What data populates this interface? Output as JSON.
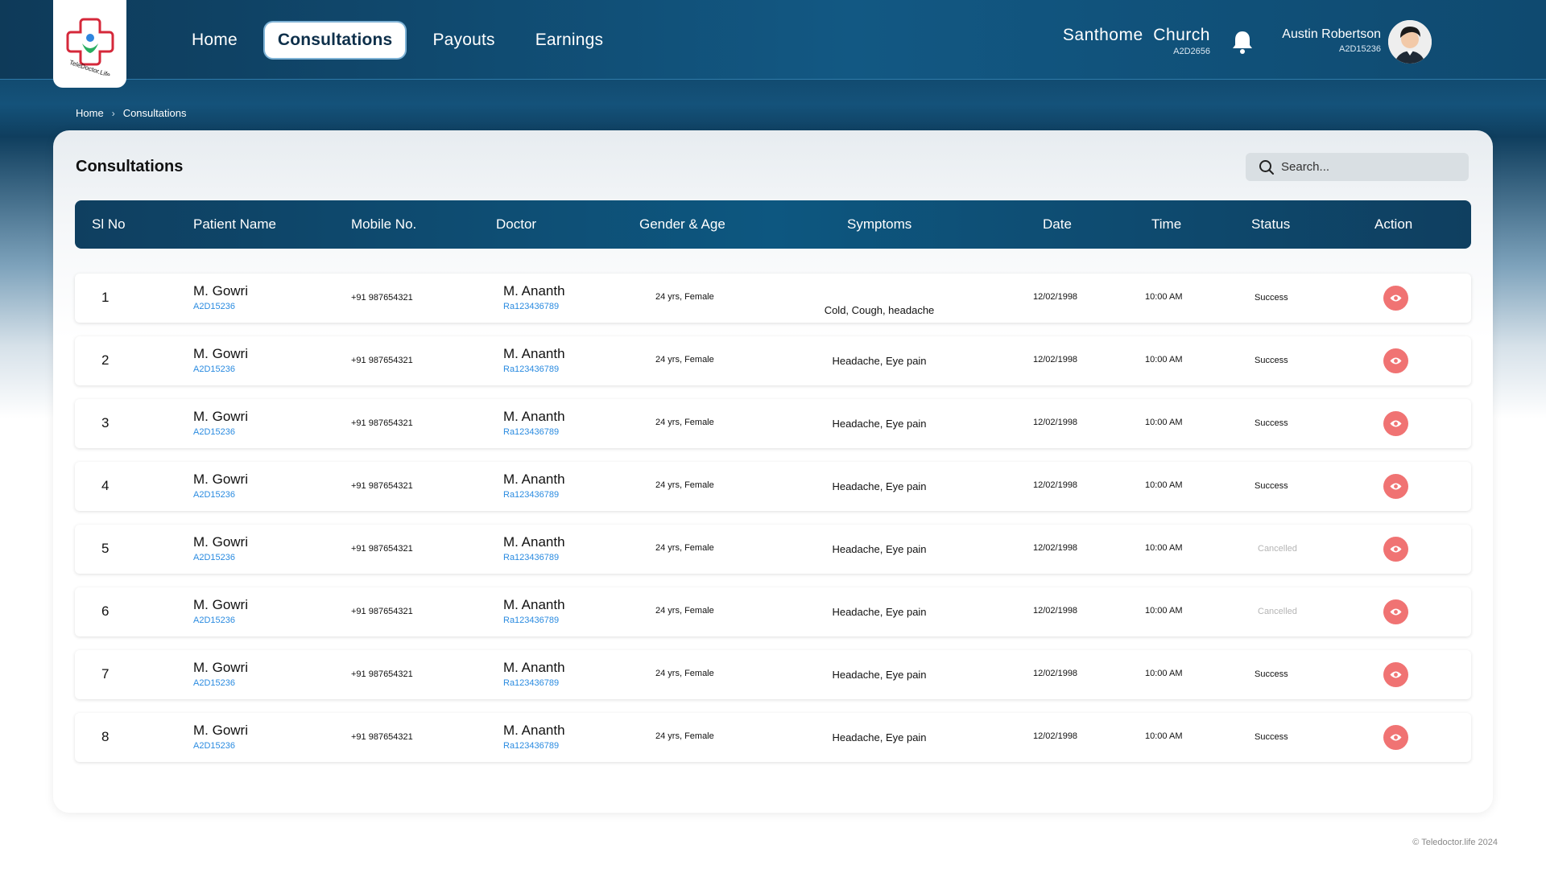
{
  "nav": {
    "logo_text": "TeleDoctor.Life",
    "items": [
      {
        "label": "Home",
        "active": false
      },
      {
        "label": "Consultations",
        "active": true
      },
      {
        "label": "Payouts",
        "active": false
      },
      {
        "label": "Earnings",
        "active": false
      }
    ]
  },
  "org": {
    "name": "Santhome  Church",
    "code": "A2D2656"
  },
  "user": {
    "name": "Austin Robertson",
    "code": "A2D15236"
  },
  "breadcrumb": {
    "home": "Home",
    "current": "Consultations"
  },
  "page": {
    "title": "Consultations",
    "search_placeholder": "Search..."
  },
  "table": {
    "headers": {
      "sl": "Sl No",
      "patient": "Patient Name",
      "mobile": "Mobile No.",
      "doctor": "Doctor",
      "gender": "Gender & Age",
      "symptoms": "Symptoms",
      "date": "Date",
      "time": "Time",
      "status": "Status",
      "action": "Action"
    },
    "rows": [
      {
        "sl": "1",
        "patient": "M. Gowri",
        "patient_id": "A2D15236",
        "mobile": "+91 987654321",
        "doctor": "M. Ananth",
        "doctor_id": "Ra123436789",
        "gender": "24 yrs, Female",
        "symptoms": "Cold, Cough, headache",
        "date": "12/02/1998",
        "time": "10:00 AM",
        "status": "Success"
      },
      {
        "sl": "2",
        "patient": "M. Gowri",
        "patient_id": "A2D15236",
        "mobile": "+91 987654321",
        "doctor": "M. Ananth",
        "doctor_id": "Ra123436789",
        "gender": "24 yrs, Female",
        "symptoms": "Headache, Eye pain",
        "date": "12/02/1998",
        "time": "10:00 AM",
        "status": "Success"
      },
      {
        "sl": "3",
        "patient": "M. Gowri",
        "patient_id": "A2D15236",
        "mobile": "+91 987654321",
        "doctor": "M. Ananth",
        "doctor_id": "Ra123436789",
        "gender": "24 yrs, Female",
        "symptoms": "Headache, Eye pain",
        "date": "12/02/1998",
        "time": "10:00 AM",
        "status": "Success"
      },
      {
        "sl": "4",
        "patient": "M. Gowri",
        "patient_id": "A2D15236",
        "mobile": "+91 987654321",
        "doctor": "M. Ananth",
        "doctor_id": "Ra123436789",
        "gender": "24 yrs, Female",
        "symptoms": "Headache, Eye pain",
        "date": "12/02/1998",
        "time": "10:00 AM",
        "status": "Success"
      },
      {
        "sl": "5",
        "patient": "M. Gowri",
        "patient_id": "A2D15236",
        "mobile": "+91 987654321",
        "doctor": "M. Ananth",
        "doctor_id": "Ra123436789",
        "gender": "24 yrs, Female",
        "symptoms": "Headache, Eye pain",
        "date": "12/02/1998",
        "time": "10:00 AM",
        "status": "Cancelled"
      },
      {
        "sl": "6",
        "patient": "M. Gowri",
        "patient_id": "A2D15236",
        "mobile": "+91 987654321",
        "doctor": "M. Ananth",
        "doctor_id": "Ra123436789",
        "gender": "24 yrs, Female",
        "symptoms": "Headache, Eye pain",
        "date": "12/02/1998",
        "time": "10:00 AM",
        "status": "Cancelled"
      },
      {
        "sl": "7",
        "patient": "M. Gowri",
        "patient_id": "A2D15236",
        "mobile": "+91 987654321",
        "doctor": "M. Ananth",
        "doctor_id": "Ra123436789",
        "gender": "24 yrs, Female",
        "symptoms": "Headache, Eye pain",
        "date": "12/02/1998",
        "time": "10:00 AM",
        "status": "Success"
      },
      {
        "sl": "8",
        "patient": "M. Gowri",
        "patient_id": "A2D15236",
        "mobile": "+91 987654321",
        "doctor": "M. Ananth",
        "doctor_id": "Ra123436789",
        "gender": "24 yrs, Female",
        "symptoms": "Headache, Eye pain",
        "date": "12/02/1998",
        "time": "10:00 AM",
        "status": "Success"
      }
    ]
  },
  "icons": {
    "search": "search-icon",
    "bell": "bell-icon",
    "action": "eye-icon",
    "chevron": "chevron-right-icon"
  },
  "colors": {
    "accent": "#0d2f4a",
    "link": "#2a8be0",
    "action": "#f07373",
    "cancelled": "#b5b5b5"
  },
  "footer": {
    "copyright": "© Teledoctor.life 2024"
  }
}
